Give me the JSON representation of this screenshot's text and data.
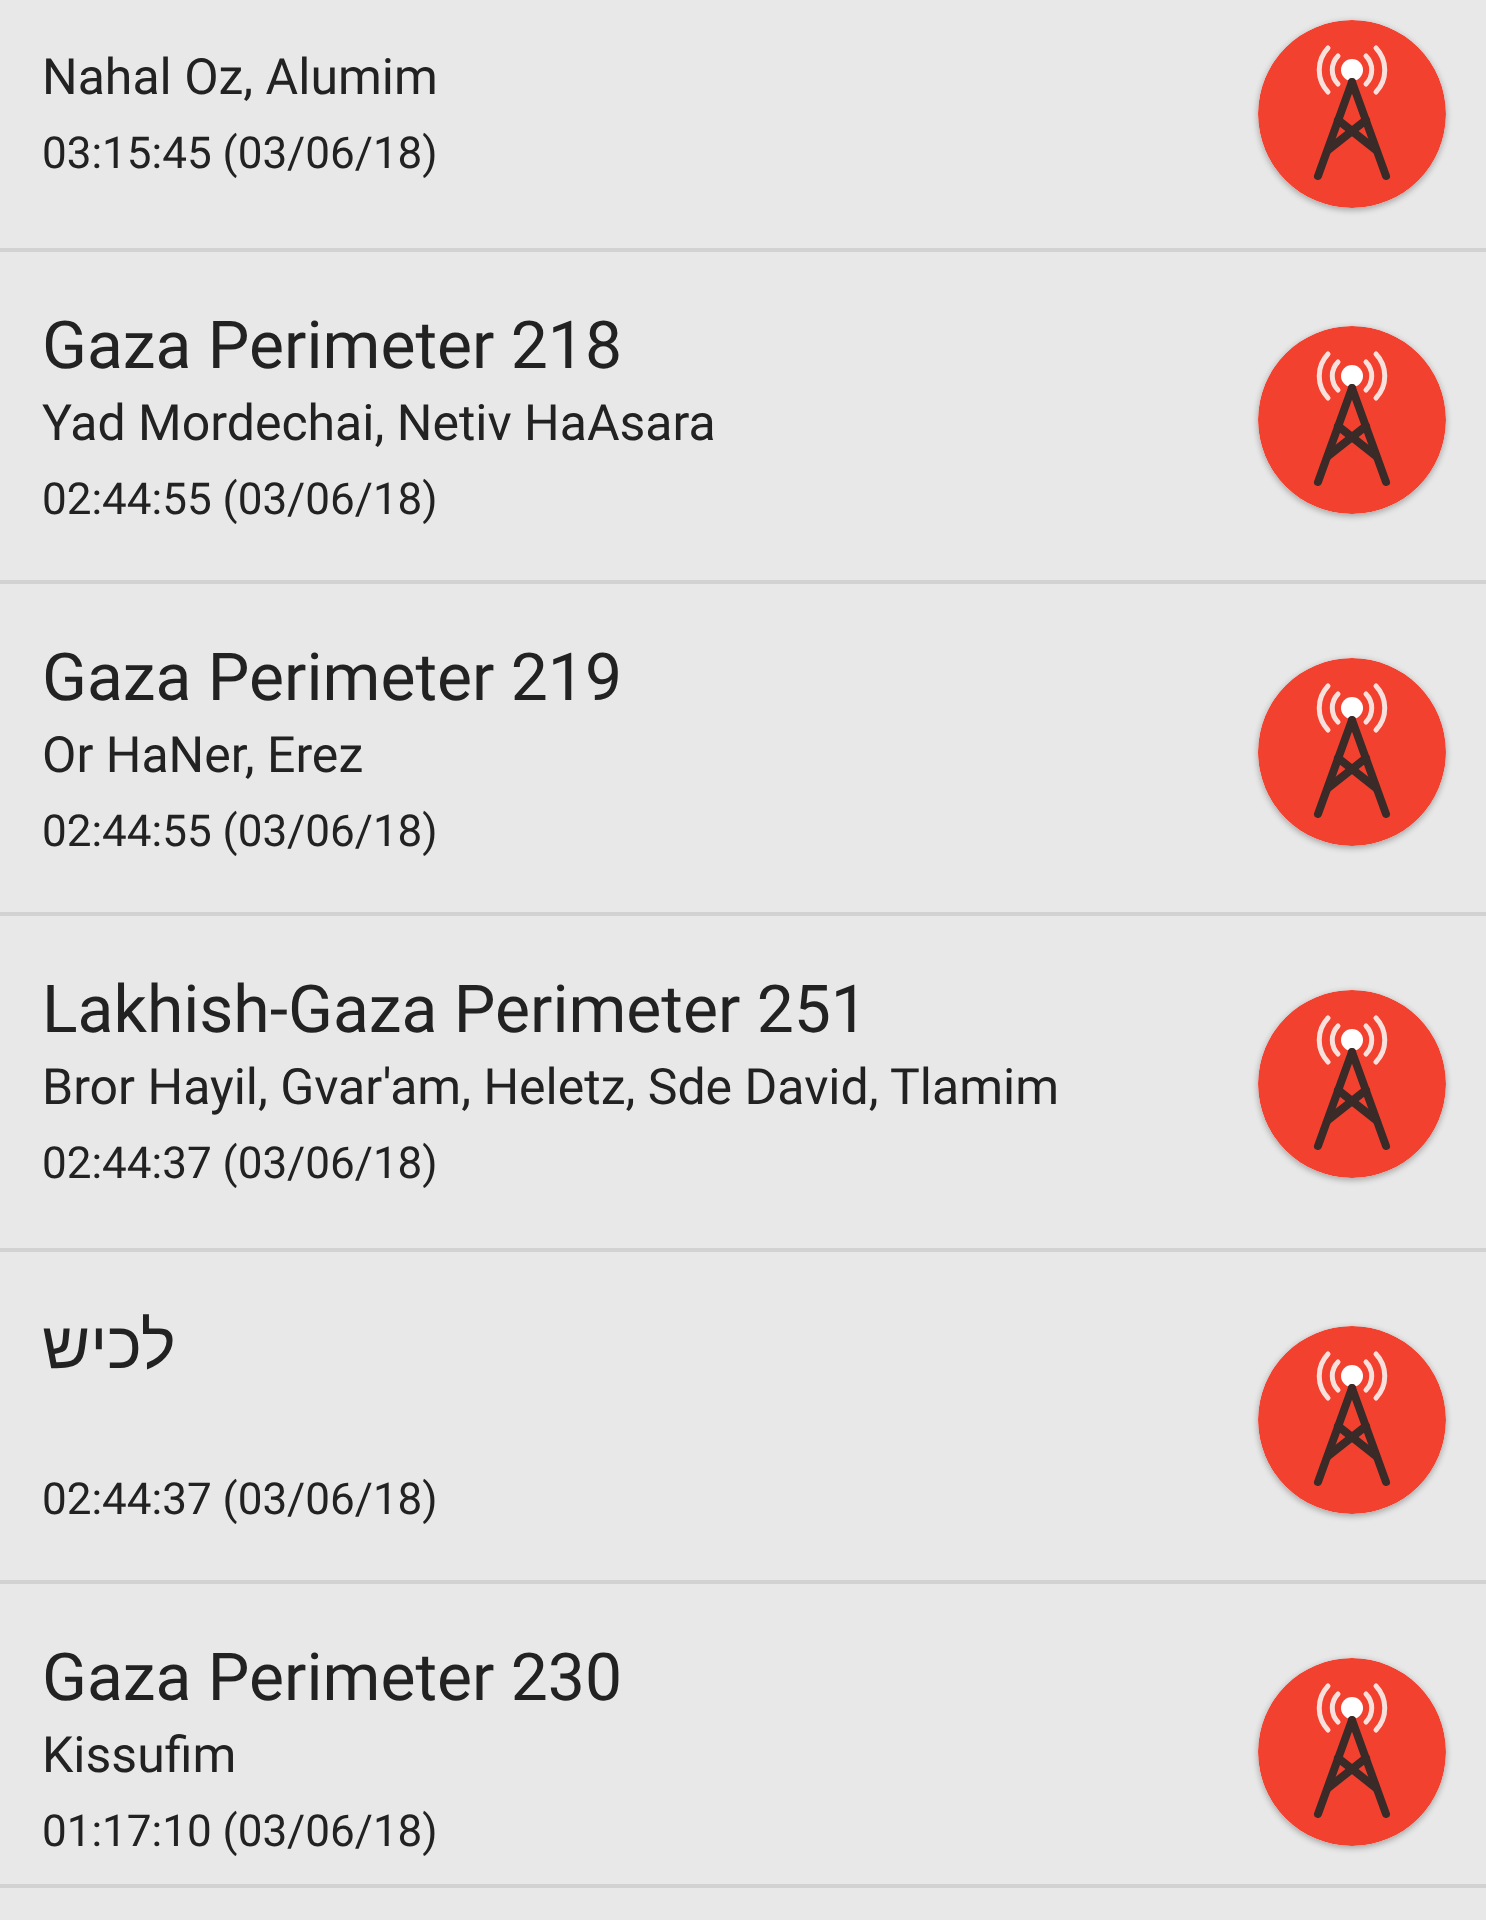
{
  "alerts": [
    {
      "area": "Nahal Oz, Alumim",
      "time": "03:15:45 (03/06/18)"
    },
    {
      "title": "Gaza Perimeter 218",
      "area": "Yad Mordechai, Netiv HaAsara",
      "time": "02:44:55 (03/06/18)"
    },
    {
      "title": "Gaza Perimeter 219",
      "area": "Or HaNer, Erez",
      "time": "02:44:55 (03/06/18)"
    },
    {
      "title": "Lakhish-Gaza Perimeter 251",
      "area": "Bror Hayil, Gvar'am, Heletz, Sde David, Tlamim",
      "time": "02:44:37 (03/06/18)"
    },
    {
      "title": "לכיש",
      "time": "02:44:37 (03/06/18)"
    },
    {
      "title": "Gaza Perimeter 230",
      "area": "Kissufim",
      "time": "01:17:10 (03/06/18)"
    }
  ]
}
